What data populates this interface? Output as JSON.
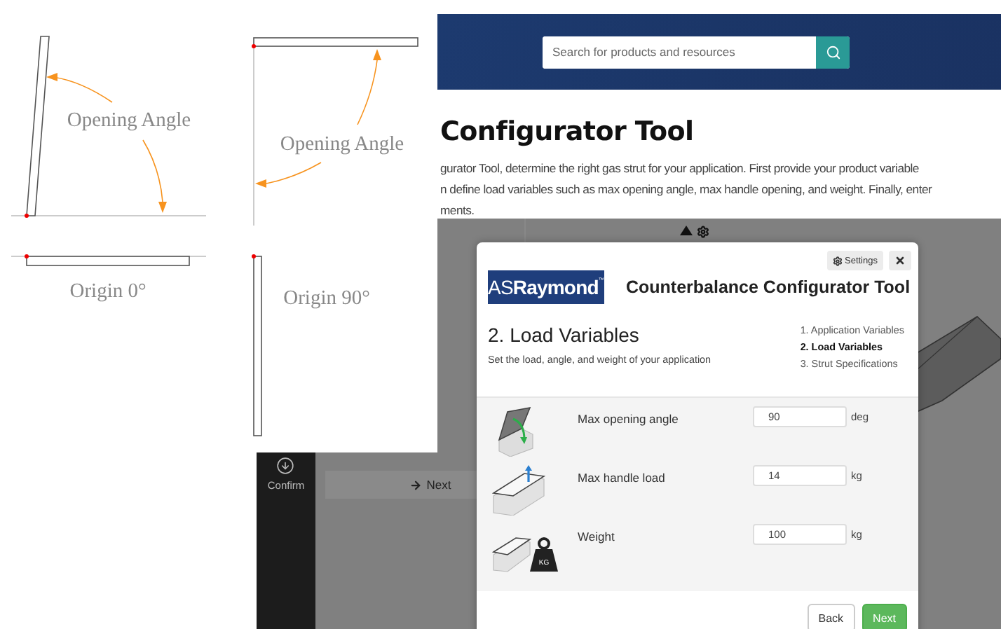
{
  "diagram": {
    "panels": [
      {
        "kind": "origin-0",
        "angle_label": "Opening Angle",
        "origin_label": "Origin 0°"
      },
      {
        "kind": "origin-90",
        "angle_label": "Opening Angle",
        "origin_label": "Origin 90°"
      }
    ]
  },
  "header": {
    "search": {
      "placeholder": "Search for products and resources"
    }
  },
  "page": {
    "title": "Configurator Tool",
    "intro_lines": [
      "gurator Tool, determine the right gas strut for your application. First provide your product variable",
      "n define load variables such as max opening angle, max handle opening, and weight. Finally, enter",
      "ments."
    ]
  },
  "sidebar": {
    "items": [
      {
        "label": "Confirm"
      }
    ]
  },
  "next_button": "Next",
  "modal": {
    "settings_button": "Settings",
    "logo": {
      "light": "AS",
      "bold": "Raymond",
      "mark": "™"
    },
    "title": "Counterbalance Configurator Tool",
    "step_title": "2. Load Variables",
    "step_subtitle": "Set the load, angle, and weight of your application",
    "steps": [
      {
        "label": "1. Application Variables",
        "selected": false
      },
      {
        "label": "2. Load Variables",
        "selected": true
      },
      {
        "label": "3. Strut Specifications",
        "selected": false
      }
    ],
    "fields": [
      {
        "kind": "angle",
        "label": "Max opening angle",
        "value": "90",
        "unit": "deg"
      },
      {
        "kind": "handle",
        "label": "Max handle load",
        "value": "14",
        "unit": "kg"
      },
      {
        "kind": "weight",
        "label": "Weight",
        "value": "100",
        "unit": "kg",
        "badge": "KG"
      }
    ],
    "back_button": "Back",
    "next_button": "Next"
  }
}
